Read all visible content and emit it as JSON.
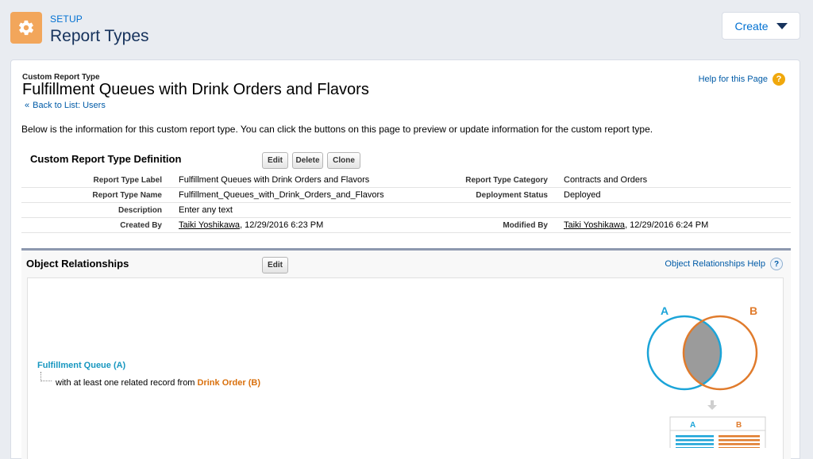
{
  "header": {
    "setup_label": "SETUP",
    "title": "Report Types",
    "create_label": "Create"
  },
  "report": {
    "small_label": "Custom Report Type",
    "title": "Fulfillment Queues with Drink Orders and Flavors",
    "back_link": "Back to List: Users",
    "back_arrow": "«",
    "help_link": "Help for this Page",
    "intro": "Below is the information for this custom report type. You can click the buttons on this page to preview or update information for the custom report type."
  },
  "definition": {
    "heading": "Custom Report Type Definition",
    "buttons": {
      "edit": "Edit",
      "delete": "Delete",
      "clone": "Clone"
    },
    "report_type_label_label": "Report Type Label",
    "report_type_label_value": "Fulfillment Queues with Drink Orders and Flavors",
    "report_type_name_label": "Report Type Name",
    "report_type_name_value": "Fulfillment_Queues_with_Drink_Orders_and_Flavors",
    "description_label": "Description",
    "description_value": "Enter any text",
    "created_by_label": "Created By",
    "created_by_user": "Taiki Yoshikawa",
    "created_by_date": ", 12/29/2016 6:23 PM",
    "category_label": "Report Type Category",
    "category_value": "Contracts and Orders",
    "deployment_label": "Deployment Status",
    "deployment_value": "Deployed",
    "modified_by_label": "Modified By",
    "modified_by_user": "Taiki Yoshikawa",
    "modified_by_date": ", 12/29/2016 6:24 PM"
  },
  "relationships": {
    "heading": "Object Relationships",
    "edit": "Edit",
    "help": "Object Relationships Help",
    "primary": "Fulfillment Queue (A)",
    "relation_text": "with at least one related record from ",
    "secondary": "Drink Order (B)",
    "venn_a": "A",
    "venn_b": "B",
    "table_a": "A",
    "table_b": "B"
  },
  "colors": {
    "a_blue": "#1ba4d8",
    "b_orange": "#e07b2c",
    "intersection": "#9b9b9b"
  }
}
